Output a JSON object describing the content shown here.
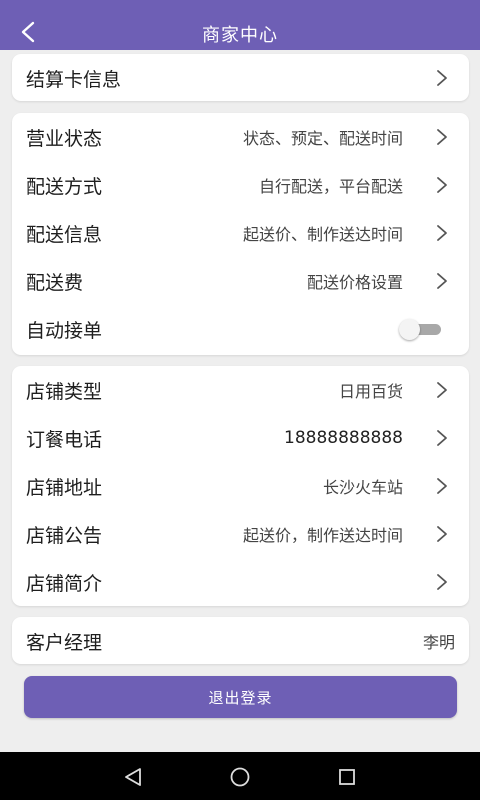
{
  "header": {
    "title": "商家中心",
    "back_icon": "chevron-left-icon",
    "bg_color": "#6e5fb5"
  },
  "card1": {
    "items": [
      {
        "label": "结算卡信息",
        "value": ""
      }
    ]
  },
  "card2": {
    "items": [
      {
        "label": "营业状态",
        "value": "状态、预定、配送时间"
      },
      {
        "label": "配送方式",
        "value": "自行配送，平台配送"
      },
      {
        "label": "配送信息",
        "value": "起送价、制作送达时间"
      },
      {
        "label": "配送费",
        "value": "配送价格设置"
      }
    ],
    "toggle": {
      "label": "自动接单",
      "on": false
    }
  },
  "card3": {
    "items": [
      {
        "label": "店铺类型",
        "value": "日用百货"
      },
      {
        "label": "订餐电话",
        "value": "18888888888"
      },
      {
        "label": "店铺地址",
        "value": "长沙火车站"
      },
      {
        "label": "店铺公告",
        "value": "起送价，制作送达时间"
      },
      {
        "label": "店铺简介",
        "value": ""
      }
    ]
  },
  "card4": {
    "label": "客户经理",
    "value": "李明"
  },
  "logout_label": "退出登录",
  "navbar": {
    "icons": [
      "back-triangle-icon",
      "home-circle-icon",
      "recents-square-icon"
    ]
  },
  "colors": {
    "accent": "#6e5fb5",
    "background": "#eeeeee",
    "card": "#ffffff"
  }
}
